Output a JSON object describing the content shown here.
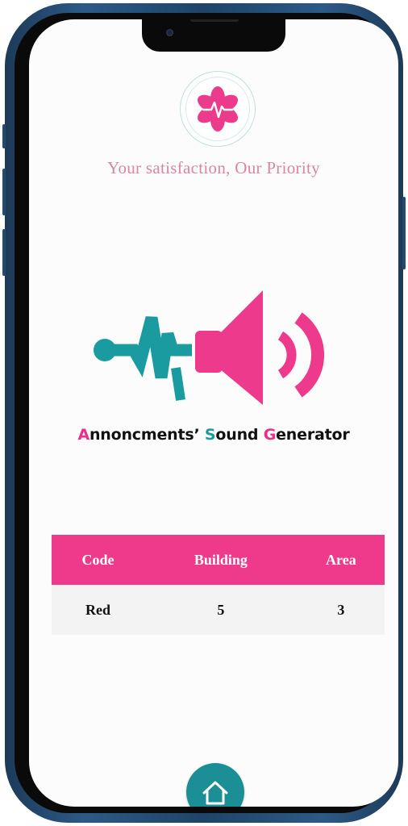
{
  "app": {
    "tagline": "Your satisfaction, Our Priority",
    "logo_icon": "heartbeat-asterisk-logo",
    "brand_colors": {
      "pink": "#ef3a8b",
      "teal": "#1a9ba0"
    }
  },
  "hero": {
    "icon": "sound-wave-speaker-icon",
    "title": {
      "w1_initial": "A",
      "w1_rest": "nnoncments’ ",
      "w2_initial": "S",
      "w2_rest": "ound ",
      "w3_initial": "G",
      "w3_rest": "enerator"
    }
  },
  "table": {
    "headers": [
      "Code",
      "Building",
      "Area"
    ],
    "rows": [
      [
        "Red",
        "5",
        "3"
      ]
    ]
  },
  "nav": {
    "home_icon": "home-icon"
  }
}
